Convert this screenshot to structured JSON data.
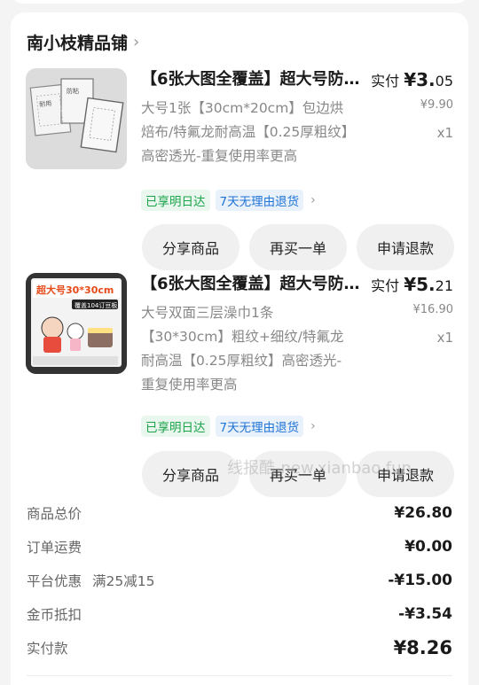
{
  "shop": {
    "name": "南小枝精品铺"
  },
  "items": [
    {
      "title": "【6张大图全覆盖】超大号防粘烤盘",
      "pay_label": "实付",
      "pay_currency": "¥",
      "pay_int": "3.",
      "pay_dec": "05",
      "orig_price": "¥9.90",
      "qty": "x1",
      "desc": "大号1张【30cm*20cm】包边烘焙布/特氟龙耐高温【0.25厚粗纹】高密透光-重复使用率更高",
      "tag_delivery": "已享明日达",
      "tag_return": "7天无理由退货",
      "thumb_text": "",
      "btn_share": "分享商品",
      "btn_rebuy": "再买一单",
      "btn_refund": "申请退款"
    },
    {
      "title": "【6张大图全覆盖】超大号防粘烤盘",
      "pay_label": "实付",
      "pay_currency": "¥",
      "pay_int": "5.",
      "pay_dec": "21",
      "orig_price": "¥16.90",
      "qty": "x1",
      "desc": "大号双面三层澡巾1条【30*30cm】粗纹+细纹/特氟龙耐高温【0.25厚粗纹】高密透光-重复使用率更高",
      "tag_delivery": "已享明日达",
      "tag_return": "7天无理由退货",
      "thumb_text": "超大号30*30cm",
      "thumb_sub": "覆盖104订豆板",
      "btn_share": "分享商品",
      "btn_rebuy": "再买一单",
      "btn_refund": "申请退款"
    }
  ],
  "summary": [
    {
      "label": "商品总价",
      "promo": "",
      "value": "¥26.80"
    },
    {
      "label": "订单运费",
      "promo": "",
      "value": "¥0.00"
    },
    {
      "label": "平台优惠",
      "promo": "满25减15",
      "value": "-¥15.00"
    },
    {
      "label": "金币抵扣",
      "promo": "",
      "value": "-¥3.54"
    },
    {
      "label": "实付款",
      "promo": "",
      "value": "¥8.26"
    }
  ],
  "watermark": "线报酷-new.xianbao.fun"
}
